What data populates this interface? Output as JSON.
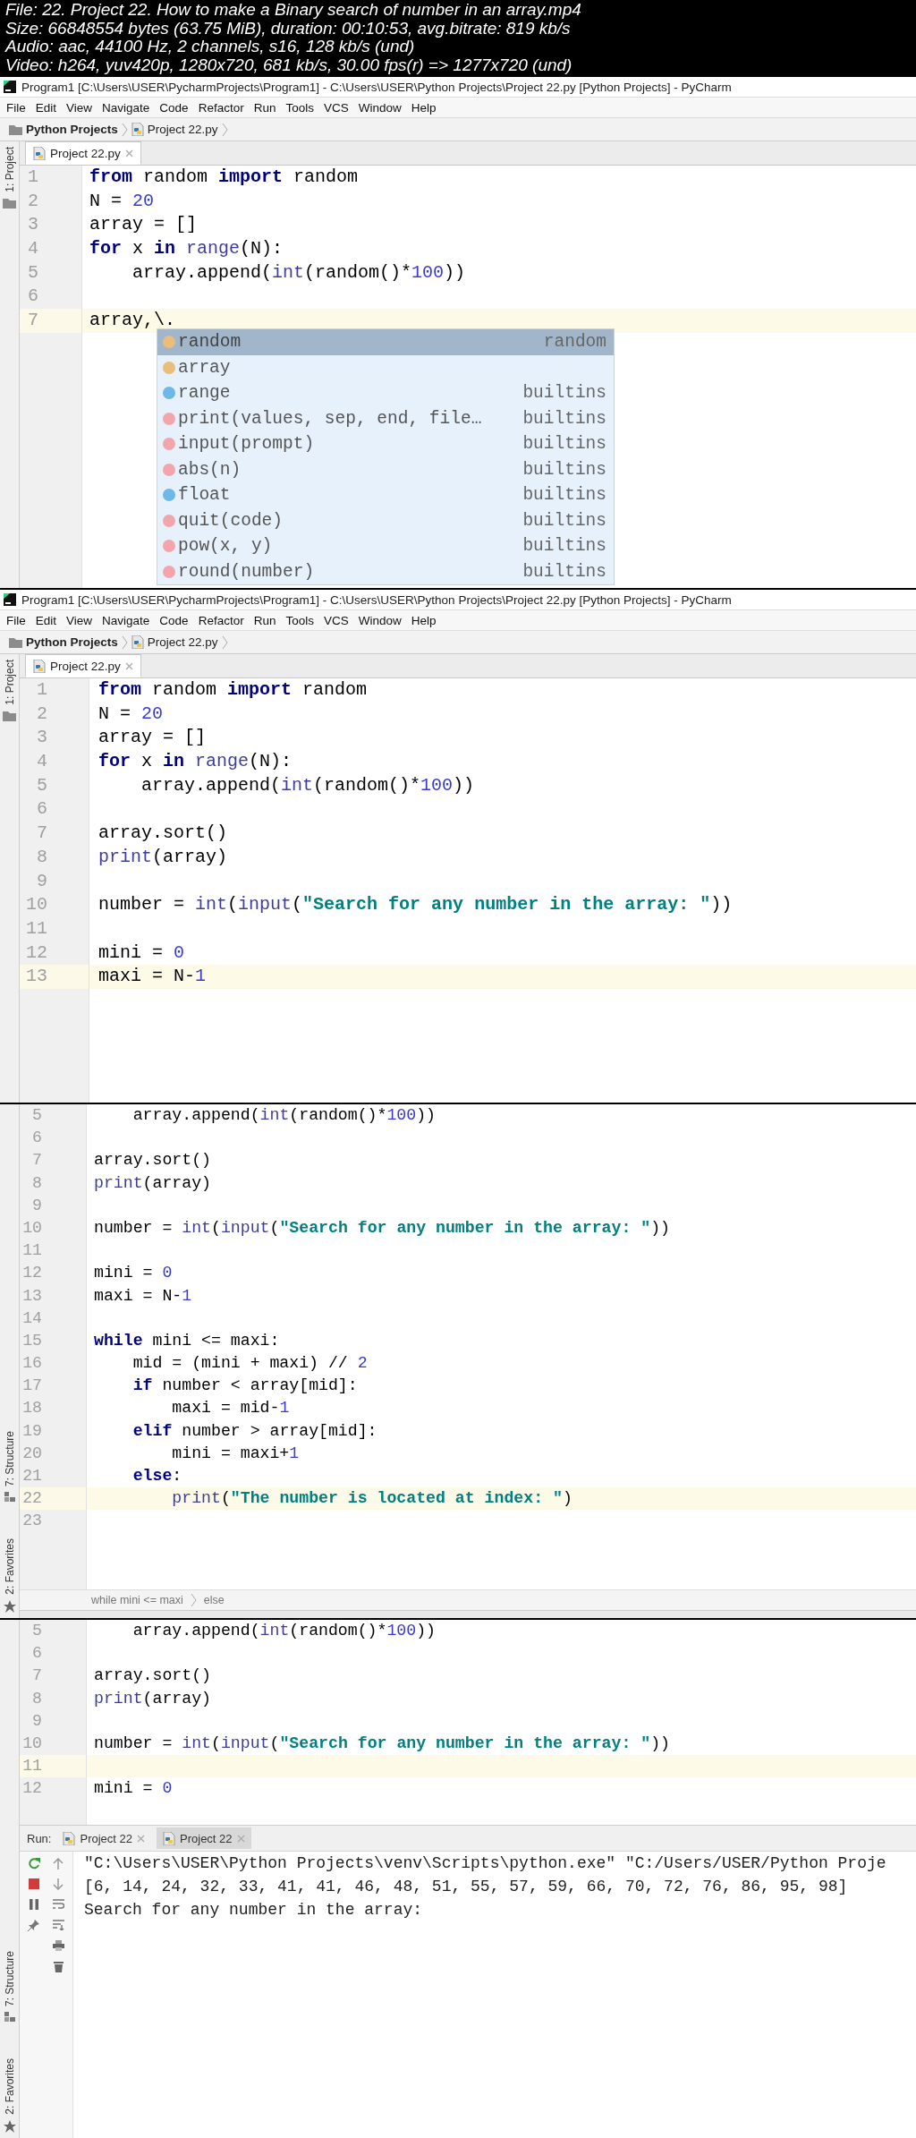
{
  "file_info": [
    "File: 22. Project 22. How to make a Binary search of number in an array.mp4",
    "Size: 66848554 bytes (63.75 MiB), duration: 00:10:53, avg.bitrate: 819 kb/s",
    "Audio: aac, 44100 Hz, 2 channels, s16, 128 kb/s (und)",
    "Video: h264, yuv420p, 1280x720, 681 kb/s, 30.00 fps(r) => 1277x720 (und)"
  ],
  "frames": [
    {
      "title_bar": {
        "title": "Program1 [C:\\Users\\USER\\PycharmProjects\\Program1] - C:\\Users\\USER\\Python Projects\\Project 22.py [Python Projects] - PyCharm"
      },
      "menu": [
        "File",
        "Edit",
        "View",
        "Navigate",
        "Code",
        "Refactor",
        "Run",
        "Tools",
        "VCS",
        "Window",
        "Help"
      ],
      "nav": [
        "Python Projects",
        "Project 22.py"
      ],
      "tabs": [
        {
          "label": "Project 22.py",
          "selected": true
        }
      ],
      "left_tools_top": [
        {
          "kind": "project",
          "label": "1: Project"
        }
      ],
      "lines": [
        {
          "number": "1",
          "current": false,
          "code": [
            {
              "kind": "kw",
              "text": "from"
            },
            {
              "kind": "plain",
              "text": " random "
            },
            {
              "kind": "kw",
              "text": "import"
            },
            {
              "kind": "plain",
              "text": " random"
            }
          ]
        },
        {
          "number": "2",
          "current": false,
          "code": [
            {
              "kind": "plain",
              "text": "N = "
            },
            {
              "kind": "num",
              "text": "20"
            }
          ]
        },
        {
          "number": "3",
          "current": false,
          "code": [
            {
              "kind": "plain",
              "text": "array = []"
            }
          ]
        },
        {
          "number": "4",
          "current": false,
          "code": [
            {
              "kind": "kw",
              "text": "for"
            },
            {
              "kind": "plain",
              "text": " x "
            },
            {
              "kind": "kw",
              "text": "in"
            },
            {
              "kind": "bi",
              "text": " range"
            },
            {
              "kind": "plain",
              "text": "(N):"
            }
          ]
        },
        {
          "number": "5",
          "current": false,
          "code": [
            {
              "kind": "plain",
              "text": "    array.append("
            },
            {
              "kind": "bi",
              "text": "int"
            },
            {
              "kind": "plain",
              "text": "(random()*"
            },
            {
              "kind": "num",
              "text": "100"
            },
            {
              "kind": "plain",
              "text": "))"
            }
          ]
        },
        {
          "number": "6",
          "current": false
        },
        {
          "number": "7",
          "current": true,
          "code": [
            {
              "kind": "plain",
              "text": "array,\\."
            }
          ]
        }
      ],
      "completion": {
        "items": [
          {
            "kind": "v",
            "name": "random",
            "source": "random",
            "selected": true
          },
          {
            "kind": "v",
            "name": "array",
            "selected": false
          },
          {
            "kind": "c",
            "name": "range",
            "source": "builtins",
            "selected": false
          },
          {
            "kind": "f",
            "name": "print(values, sep, end, file…",
            "source": "builtins",
            "selected": false
          },
          {
            "kind": "f",
            "name": "input(prompt)",
            "source": "builtins",
            "selected": false
          },
          {
            "kind": "f",
            "name": "abs(n)",
            "source": "builtins",
            "selected": false
          },
          {
            "kind": "c",
            "name": "float",
            "source": "builtins",
            "selected": false
          },
          {
            "kind": "f",
            "name": "quit(code)",
            "source": "builtins",
            "selected": false
          },
          {
            "kind": "f",
            "name": "pow(x, y)",
            "source": "builtins",
            "selected": false
          },
          {
            "kind": "f",
            "name": "round(number)",
            "source": "builtins",
            "selected": false
          }
        ]
      }
    },
    {
      "title_bar": {
        "title": "Program1 [C:\\Users\\USER\\PycharmProjects\\Program1] - C:\\Users\\USER\\Python Projects\\Project 22.py [Python Projects] - PyCharm"
      },
      "menu": [
        "File",
        "Edit",
        "View",
        "Navigate",
        "Code",
        "Refactor",
        "Run",
        "Tools",
        "VCS",
        "Window",
        "Help"
      ],
      "nav": [
        "Python Projects",
        "Project 22.py"
      ],
      "tabs": [
        {
          "label": "Project 22.py",
          "selected": true
        }
      ],
      "left_tools_top": [
        {
          "kind": "project",
          "label": "1: Project"
        }
      ],
      "lines": [
        {
          "number": "1",
          "current": false,
          "code": [
            {
              "kind": "kw",
              "text": "from"
            },
            {
              "kind": "plain",
              "text": " random "
            },
            {
              "kind": "kw",
              "text": "import"
            },
            {
              "kind": "plain",
              "text": " random"
            }
          ]
        },
        {
          "number": "2",
          "current": false,
          "code": [
            {
              "kind": "plain",
              "text": "N = "
            },
            {
              "kind": "num",
              "text": "20"
            }
          ]
        },
        {
          "number": "3",
          "current": false,
          "code": [
            {
              "kind": "plain",
              "text": "array = []"
            }
          ]
        },
        {
          "number": "4",
          "current": false,
          "code": [
            {
              "kind": "kw",
              "text": "for"
            },
            {
              "kind": "plain",
              "text": " x "
            },
            {
              "kind": "kw",
              "text": "in"
            },
            {
              "kind": "bi",
              "text": " range"
            },
            {
              "kind": "plain",
              "text": "(N):"
            }
          ]
        },
        {
          "number": "5",
          "current": false,
          "code": [
            {
              "kind": "plain",
              "text": "    array.append("
            },
            {
              "kind": "bi",
              "text": "int"
            },
            {
              "kind": "plain",
              "text": "(random()*"
            },
            {
              "kind": "num",
              "text": "100"
            },
            {
              "kind": "plain",
              "text": "))"
            }
          ]
        },
        {
          "number": "6",
          "current": false
        },
        {
          "number": "7",
          "current": false,
          "code": [
            {
              "kind": "plain",
              "text": "array.sort()"
            }
          ]
        },
        {
          "number": "8",
          "current": false,
          "code": [
            {
              "kind": "bi",
              "text": "print"
            },
            {
              "kind": "plain",
              "text": "(array)"
            }
          ]
        },
        {
          "number": "9",
          "current": false
        },
        {
          "number": "10",
          "current": false,
          "code": [
            {
              "kind": "plain",
              "text": "number = "
            },
            {
              "kind": "bi",
              "text": "int"
            },
            {
              "kind": "plain",
              "text": "("
            },
            {
              "kind": "bi",
              "text": "input"
            },
            {
              "kind": "plain",
              "text": "("
            },
            {
              "kind": "str",
              "text": "\"Search for any number in the array: \""
            },
            {
              "kind": "plain",
              "text": "))"
            }
          ]
        },
        {
          "number": "11",
          "current": false
        },
        {
          "number": "12",
          "current": false,
          "code": [
            {
              "kind": "plain",
              "text": "mini = "
            },
            {
              "kind": "num",
              "text": "0"
            }
          ]
        },
        {
          "number": "13",
          "current": true,
          "code": [
            {
              "kind": "plain",
              "text": "maxi = N-"
            },
            {
              "kind": "num",
              "text": "1"
            }
          ]
        }
      ]
    },
    {
      "left_tools_bottom": [
        {
          "kind": "structure",
          "label": "7: Structure"
        },
        {
          "kind": "favorites",
          "label": "2: Favorites"
        }
      ],
      "lines": [
        {
          "number": "5",
          "current": false,
          "code": [
            {
              "kind": "plain",
              "text": "    array.append("
            },
            {
              "kind": "bi",
              "text": "int"
            },
            {
              "kind": "plain",
              "text": "(random()*"
            },
            {
              "kind": "num",
              "text": "100"
            },
            {
              "kind": "plain",
              "text": "))"
            }
          ]
        },
        {
          "number": "6",
          "current": false
        },
        {
          "number": "7",
          "current": false,
          "code": [
            {
              "kind": "plain",
              "text": "array.sort()"
            }
          ]
        },
        {
          "number": "8",
          "current": false,
          "code": [
            {
              "kind": "bi",
              "text": "print"
            },
            {
              "kind": "plain",
              "text": "(array)"
            }
          ]
        },
        {
          "number": "9",
          "current": false
        },
        {
          "number": "10",
          "current": false,
          "code": [
            {
              "kind": "plain",
              "text": "number = "
            },
            {
              "kind": "bi",
              "text": "int"
            },
            {
              "kind": "plain",
              "text": "("
            },
            {
              "kind": "bi",
              "text": "input"
            },
            {
              "kind": "plain",
              "text": "("
            },
            {
              "kind": "str",
              "text": "\"Search for any number in the array: \""
            },
            {
              "kind": "plain",
              "text": "))"
            }
          ]
        },
        {
          "number": "11",
          "current": false
        },
        {
          "number": "12",
          "current": false,
          "code": [
            {
              "kind": "plain",
              "text": "mini = "
            },
            {
              "kind": "num",
              "text": "0"
            }
          ]
        },
        {
          "number": "13",
          "current": false,
          "code": [
            {
              "kind": "plain",
              "text": "maxi = N-"
            },
            {
              "kind": "num",
              "text": "1"
            }
          ]
        },
        {
          "number": "14",
          "current": false
        },
        {
          "number": "15",
          "current": false,
          "code": [
            {
              "kind": "kw",
              "text": "while"
            },
            {
              "kind": "plain",
              "text": " mini <= maxi:"
            }
          ]
        },
        {
          "number": "16",
          "current": false,
          "code": [
            {
              "kind": "plain",
              "text": "    mid = (mini + maxi) // "
            },
            {
              "kind": "num",
              "text": "2"
            }
          ]
        },
        {
          "number": "17",
          "current": false,
          "code": [
            {
              "kind": "kw",
              "text": "    if"
            },
            {
              "kind": "plain",
              "text": " number < array[mid]:"
            }
          ]
        },
        {
          "number": "18",
          "current": false,
          "code": [
            {
              "kind": "plain",
              "text": "        maxi = mid-"
            },
            {
              "kind": "num",
              "text": "1"
            }
          ]
        },
        {
          "number": "19",
          "current": false,
          "code": [
            {
              "kind": "kw",
              "text": "    elif"
            },
            {
              "kind": "plain",
              "text": " number > array[mid]:"
            }
          ]
        },
        {
          "number": "20",
          "current": false,
          "code": [
            {
              "kind": "plain",
              "text": "        mini = maxi+"
            },
            {
              "kind": "num",
              "text": "1"
            }
          ]
        },
        {
          "number": "21",
          "current": false,
          "code": [
            {
              "kind": "kw",
              "text": "    else"
            },
            {
              "kind": "plain",
              "text": ":"
            }
          ]
        },
        {
          "number": "22",
          "current": true,
          "code": [
            {
              "kind": "bi",
              "text": "        print"
            },
            {
              "kind": "plain",
              "text": "("
            },
            {
              "kind": "str",
              "text": "\"The number is located at index: \""
            },
            {
              "kind": "plain",
              "text": ")"
            }
          ]
        },
        {
          "number": "23",
          "current": false
        }
      ],
      "breadcrumb": [
        "while mini <= maxi",
        "else"
      ]
    },
    {
      "left_tools_bottom": [
        {
          "kind": "structure",
          "label": "7: Structure"
        },
        {
          "kind": "favorites",
          "label": "2: Favorites"
        }
      ],
      "lines": [
        {
          "number": "5",
          "current": false,
          "code": [
            {
              "kind": "plain",
              "text": "    array.append("
            },
            {
              "kind": "bi",
              "text": "int"
            },
            {
              "kind": "plain",
              "text": "(random()*"
            },
            {
              "kind": "num",
              "text": "100"
            },
            {
              "kind": "plain",
              "text": "))"
            }
          ]
        },
        {
          "number": "6",
          "current": false
        },
        {
          "number": "7",
          "current": false,
          "code": [
            {
              "kind": "plain",
              "text": "array.sort()"
            }
          ]
        },
        {
          "number": "8",
          "current": false,
          "code": [
            {
              "kind": "bi",
              "text": "print"
            },
            {
              "kind": "plain",
              "text": "(array)"
            }
          ]
        },
        {
          "number": "9",
          "current": false
        },
        {
          "number": "10",
          "current": false,
          "code": [
            {
              "kind": "plain",
              "text": "number = "
            },
            {
              "kind": "bi",
              "text": "int"
            },
            {
              "kind": "plain",
              "text": "("
            },
            {
              "kind": "bi",
              "text": "input"
            },
            {
              "kind": "plain",
              "text": "("
            },
            {
              "kind": "str",
              "text": "\"Search for any number in the array: \""
            },
            {
              "kind": "plain",
              "text": "))"
            }
          ]
        },
        {
          "number": "11",
          "current": true
        },
        {
          "number": "12",
          "current": false,
          "code": [
            {
              "kind": "plain",
              "text": "mini = "
            },
            {
              "kind": "num",
              "text": "0"
            }
          ]
        }
      ],
      "run_panel": {
        "label": "Run:",
        "tabs": [
          {
            "label": "Project 22",
            "selected": false
          },
          {
            "label": "Project 22",
            "selected": true
          }
        ],
        "console": [
          "\"C:\\Users\\USER\\Python Projects\\venv\\Scripts\\python.exe\" \"C:/Users/USER/Python Proje",
          "[6, 14, 24, 32, 33, 41, 41, 46, 48, 51, 55, 57, 59, 66, 70, 72, 76, 86, 95, 98]",
          "Search for any number in the array: "
        ]
      }
    }
  ]
}
